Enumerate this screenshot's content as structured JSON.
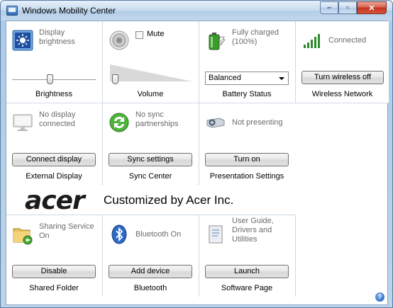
{
  "window": {
    "title": "Windows Mobility Center",
    "controls": {
      "minimize": "–",
      "maximize": "▫",
      "close": "✕"
    }
  },
  "tiles": {
    "brightness": {
      "status": "Display brightness",
      "label": "Brightness",
      "icon": "display-brightness-icon",
      "level": 0.45
    },
    "volume": {
      "mute_label": "Mute",
      "label": "Volume",
      "icon": "speaker-icon",
      "muted": false,
      "level": 0.05
    },
    "battery": {
      "status": "Fully charged (100%)",
      "select_value": "Balanced",
      "label": "Battery Status",
      "icon": "battery-icon"
    },
    "wireless": {
      "status": "Connected",
      "button": "Turn wireless off",
      "label": "Wireless Network",
      "icon": "signal-bars-icon"
    },
    "external_display": {
      "status": "No display connected",
      "button": "Connect display",
      "label": "External Display",
      "icon": "monitor-icon"
    },
    "sync_center": {
      "status": "No sync partnerships",
      "button": "Sync settings",
      "label": "Sync Center",
      "icon": "sync-icon"
    },
    "presentation": {
      "status": "Not presenting",
      "button": "Turn on",
      "label": "Presentation Settings",
      "icon": "projector-icon"
    },
    "shared_folder": {
      "status": "Sharing Service On",
      "button": "Disable",
      "label": "Shared Folder",
      "icon": "shared-folder-icon"
    },
    "bluetooth": {
      "status": "Bluetooth On",
      "button": "Add device",
      "label": "Bluetooth",
      "icon": "bluetooth-icon"
    },
    "software_page": {
      "status": "User Guide, Drivers and Utilities",
      "button": "Launch",
      "label": "Software Page",
      "icon": "document-icon"
    }
  },
  "brand": {
    "logo": "acer",
    "text": "Customized by Acer Inc."
  },
  "help": "?",
  "colors": {
    "window_frame": "#aecbe6",
    "tile_bg": "#ffffff",
    "separator": "#cfd9e4",
    "status_text": "#6b6b6b",
    "close_button": "#c0341f"
  }
}
